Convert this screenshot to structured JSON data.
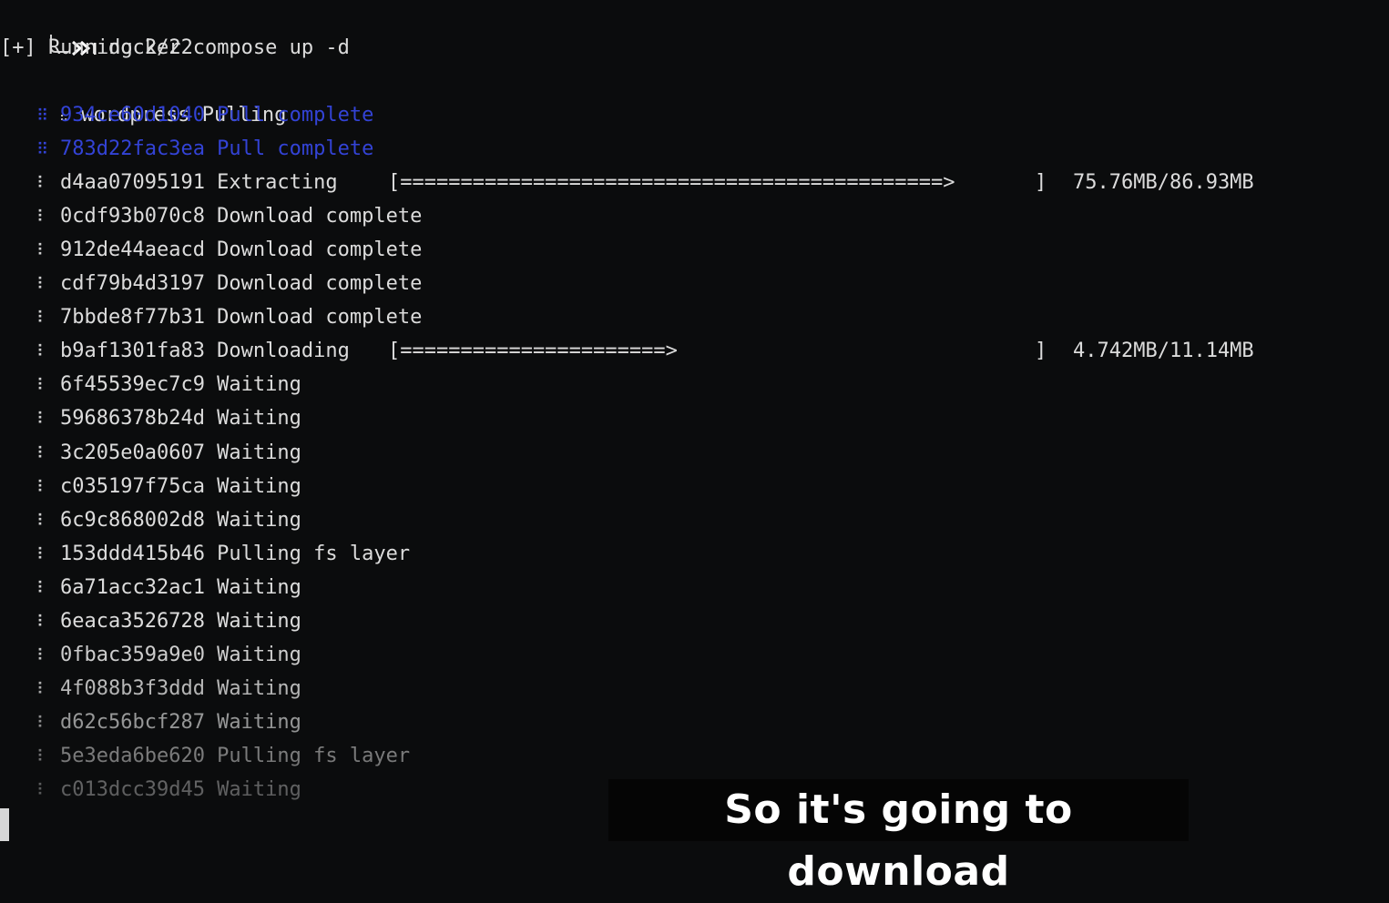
{
  "terminal": {
    "command": "docker compose up -d",
    "status": "[+] Running 2/22",
    "service": {
      "spinner": "⠦",
      "label": "wordpress Pulling"
    },
    "layers": [
      {
        "spinner": "⠿",
        "text": "934ce60d1040 Pull complete",
        "state": "done"
      },
      {
        "spinner": "⠿",
        "text": "783d22fac3ea Pull complete",
        "state": "done"
      },
      {
        "spinner": "⠇",
        "text": "d4aa07095191 Extracting",
        "state": "progress",
        "bar": "[=============================================>",
        "bar_close": "]",
        "size": "75.76MB/86.93MB",
        "progress": 0.8715
      },
      {
        "spinner": "⠇",
        "text": "0cdf93b070c8 Download complete",
        "state": "active"
      },
      {
        "spinner": "⠇",
        "text": "912de44aeacd Download complete",
        "state": "active"
      },
      {
        "spinner": "⠇",
        "text": "cdf79b4d3197 Download complete",
        "state": "active"
      },
      {
        "spinner": "⠇",
        "text": "7bbde8f77b31 Download complete",
        "state": "active"
      },
      {
        "spinner": "⠇",
        "text": "b9af1301fa83 Downloading",
        "state": "progress",
        "bar": "[======================>",
        "bar_close": "]",
        "size": "4.742MB/11.14MB",
        "progress": 0.4257
      },
      {
        "spinner": "⠇",
        "text": "6f45539ec7c9 Waiting",
        "state": "active"
      },
      {
        "spinner": "⠇",
        "text": "59686378b24d Waiting",
        "state": "active"
      },
      {
        "spinner": "⠇",
        "text": "3c205e0a0607 Waiting",
        "state": "active"
      },
      {
        "spinner": "⠇",
        "text": "c035197f75ca Waiting",
        "state": "active"
      },
      {
        "spinner": "⠇",
        "text": "6c9c868002d8 Waiting",
        "state": "active"
      },
      {
        "spinner": "⠇",
        "text": "153ddd415b46 Pulling fs layer",
        "state": "active"
      },
      {
        "spinner": "⠇",
        "text": "6a71acc32ac1 Waiting",
        "state": "active"
      },
      {
        "spinner": "⠇",
        "text": "6eaca3526728 Waiting",
        "state": "active"
      },
      {
        "spinner": "⠇",
        "text": "0fbac359a9e0 Waiting",
        "state": "active"
      },
      {
        "spinner": "⠇",
        "text": "4f088b3f3ddd Waiting",
        "state": "active"
      },
      {
        "spinner": "⠇",
        "text": "d62c56bcf287 Waiting",
        "state": "active"
      },
      {
        "spinner": "⠇",
        "text": "5e3eda6be620 Pulling fs layer",
        "state": "active"
      },
      {
        "spinner": "⠇",
        "text": "c013dcc39d45 Waiting",
        "state": "active"
      }
    ]
  },
  "caption": "So it's going to download",
  "colors": {
    "background": "#0b0c0d",
    "text": "#dcdcdc",
    "complete": "#3343d6"
  }
}
